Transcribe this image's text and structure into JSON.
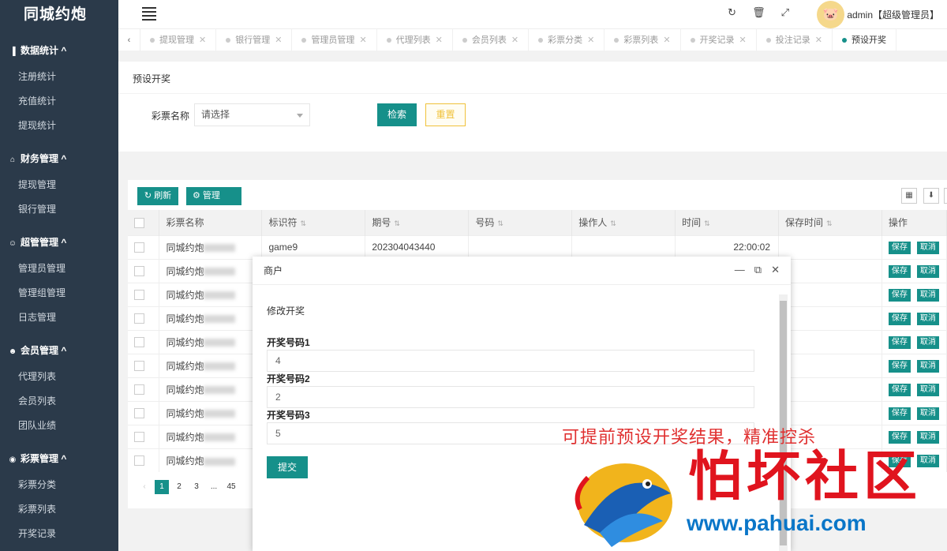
{
  "app": {
    "logo": "同城约炮"
  },
  "sidebar": {
    "groups": [
      {
        "label": "数据统计 ^",
        "icon": "bar-chart-icon",
        "items": [
          "注册统计",
          "充值统计",
          "提现统计"
        ]
      },
      {
        "label": "财务管理 ^",
        "icon": "bank-icon",
        "items": [
          "提现管理",
          "银行管理"
        ]
      },
      {
        "label": "超管管理 ^",
        "icon": "user-icon",
        "items": [
          "管理员管理",
          "管理组管理",
          "日志管理"
        ]
      },
      {
        "label": "会员管理 ^",
        "icon": "users-icon",
        "items": [
          "代理列表",
          "会员列表",
          "团队业绩"
        ]
      },
      {
        "label": "彩票管理 ^",
        "icon": "gamepad-icon",
        "items": [
          "彩票分类",
          "彩票列表",
          "开奖记录"
        ]
      }
    ]
  },
  "header": {
    "admin": "admin【超级管理员】"
  },
  "tabs": [
    {
      "label": "提现管理"
    },
    {
      "label": "银行管理"
    },
    {
      "label": "管理员管理"
    },
    {
      "label": "代理列表"
    },
    {
      "label": "会员列表"
    },
    {
      "label": "彩票分类"
    },
    {
      "label": "彩票列表"
    },
    {
      "label": "开奖记录"
    },
    {
      "label": "投注记录"
    },
    {
      "label": "预设开奖",
      "active": true
    }
  ],
  "search": {
    "title": "预设开奖",
    "label": "彩票名称",
    "placeholder": "请选择",
    "search_btn": "检索",
    "reset_btn": "重置"
  },
  "toolbar": {
    "refresh": "刷新",
    "setting": "管理"
  },
  "table": {
    "columns": [
      "彩票名称",
      "标识符",
      "期号",
      "号码",
      "操作人",
      "时间",
      "保存时间",
      "操作"
    ],
    "first_row": {
      "name": "同城约炮",
      "ident": "game9",
      "issue": "202304043440",
      "time": "22:00:02"
    },
    "row_name": "同城约炮",
    "save": "保存",
    "cancel": "取消",
    "row_count": 10
  },
  "pager": {
    "prev": "‹",
    "pages": [
      "1",
      "2",
      "3",
      "...",
      "45"
    ]
  },
  "modal": {
    "title": "商户",
    "heading": "修改开奖",
    "fields": [
      {
        "label": "开奖号码1",
        "value": "4"
      },
      {
        "label": "开奖号码2",
        "value": "2"
      },
      {
        "label": "开奖号码3",
        "value": "5"
      }
    ],
    "submit": "提交"
  },
  "overlay": {
    "annotation": "可提前预设开奖结果，精准控杀",
    "watermark": "怕坏社区",
    "watermark_url": "www.pahuai.com",
    "arrow_color": "#d93030"
  }
}
